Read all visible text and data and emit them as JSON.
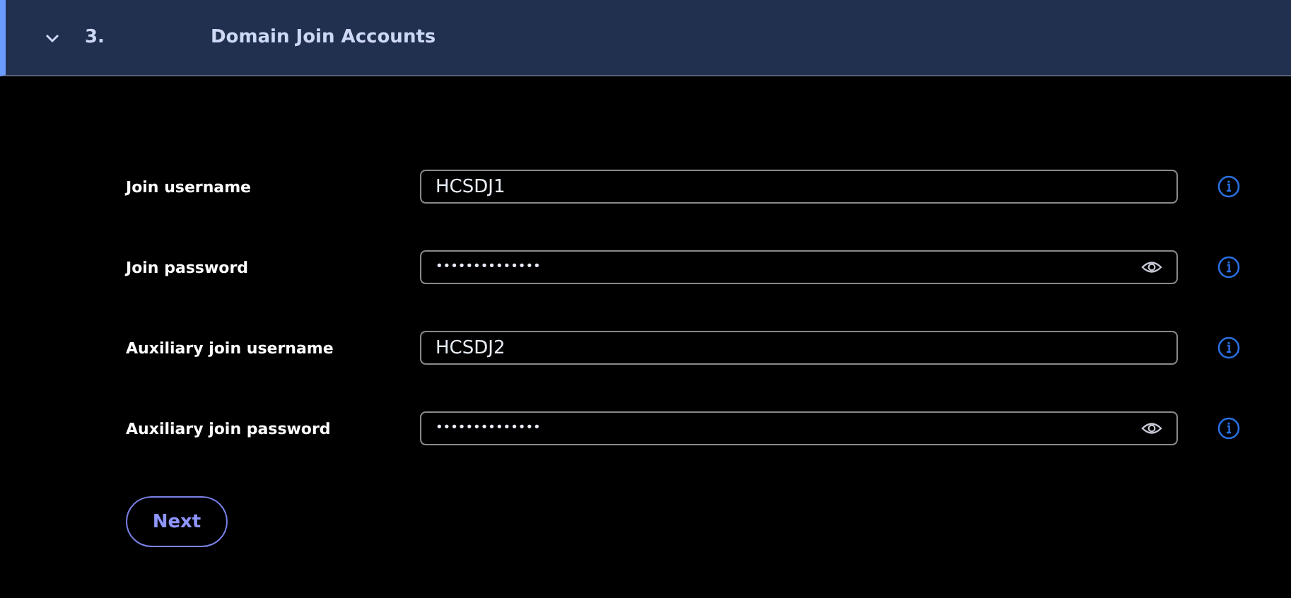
{
  "section": {
    "number": "3.",
    "title": "Domain Join Accounts",
    "expanded": true
  },
  "fields": [
    {
      "label": "Join username",
      "kind": "text",
      "value": "HCSDJ1"
    },
    {
      "label": "Join password",
      "kind": "password",
      "value": "••••••••••••••"
    },
    {
      "label": "Auxiliary join username",
      "kind": "text",
      "value": "HCSDJ2"
    },
    {
      "label": "Auxiliary join password",
      "kind": "password",
      "value": "••••••••••••••"
    }
  ],
  "button": "Next"
}
